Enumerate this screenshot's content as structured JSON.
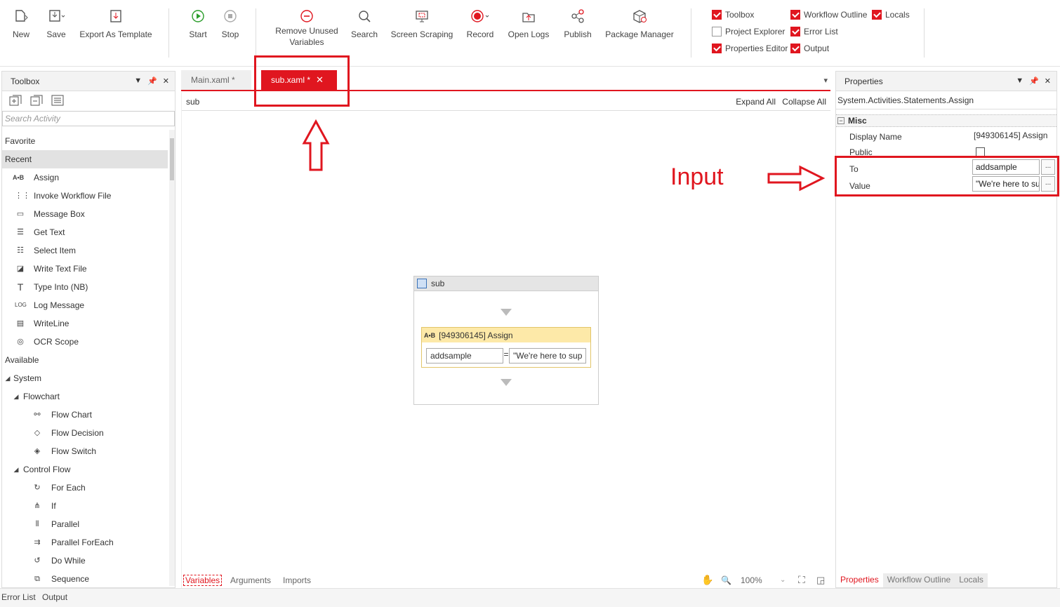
{
  "ribbon": {
    "buttons": [
      {
        "label": "New",
        "icon": "new-file-icon"
      },
      {
        "label": "Save",
        "icon": "save-icon"
      },
      {
        "label": "Export As Template",
        "icon": "export-template-icon"
      },
      {
        "label": "Start",
        "icon": "play-icon"
      },
      {
        "label": "Stop",
        "icon": "stop-icon"
      },
      {
        "label": "Remove Unused\nVariables",
        "icon": "remove-icon"
      },
      {
        "label": "Search",
        "icon": "search-icon"
      },
      {
        "label": "Screen Scraping",
        "icon": "screen-scraping-icon"
      },
      {
        "label": "Record",
        "icon": "record-icon"
      },
      {
        "label": "Open Logs",
        "icon": "open-logs-icon"
      },
      {
        "label": "Publish",
        "icon": "publish-icon"
      },
      {
        "label": "Package Manager",
        "icon": "package-icon"
      }
    ],
    "toggles": [
      {
        "label": "Toolbox",
        "checked": true
      },
      {
        "label": "Workflow Outline",
        "checked": true
      },
      {
        "label": "Locals",
        "checked": true
      },
      {
        "label": "Project Explorer",
        "checked": false
      },
      {
        "label": "Error List",
        "checked": true
      },
      {
        "label": "Properties Editor",
        "checked": true
      },
      {
        "label": "Output",
        "checked": true
      }
    ]
  },
  "toolbox": {
    "title": "Toolbox",
    "search_placeholder": "Search Activity",
    "favorite": "Favorite",
    "recent": "Recent",
    "recent_items": [
      "Assign",
      "Invoke Workflow File",
      "Message Box",
      "Get Text",
      "Select Item",
      "Write Text File",
      "Type Into (NB)",
      "Log Message",
      "WriteLine",
      "OCR Scope"
    ],
    "available": "Available",
    "system": "System",
    "flowchart": "Flowchart",
    "flowchart_items": [
      "Flow Chart",
      "Flow Decision",
      "Flow Switch"
    ],
    "control_flow": "Control Flow",
    "control_items": [
      "For Each",
      "If",
      "Parallel",
      "Parallel ForEach",
      "Do While",
      "Sequence"
    ]
  },
  "tabs": [
    {
      "label": "Main.xaml *",
      "active": false
    },
    {
      "label": "sub.xaml *",
      "active": true
    }
  ],
  "designer": {
    "breadcrumb": "sub",
    "expand_all": "Expand All",
    "collapse_all": "Collapse All",
    "sequence_title": "sub",
    "assign_title": "[949306145] Assign",
    "assign_to": "addsample",
    "assign_eq": "=",
    "assign_value": "\"We're here to sup",
    "bottom_tabs": [
      "Variables",
      "Arguments",
      "Imports"
    ],
    "zoom": "100%"
  },
  "annotation": {
    "input_label": "Input"
  },
  "properties": {
    "title": "Properties",
    "type": "System.Activities.Statements.Assign",
    "category": "Misc",
    "rows": [
      {
        "name": "Display Name",
        "value": "[949306145] Assign"
      },
      {
        "name": "Public",
        "value": ""
      },
      {
        "name": "To",
        "value": "addsample"
      },
      {
        "name": "Value",
        "value": "\"We're here to su"
      }
    ],
    "ellipsis": "...",
    "bottom_tabs": [
      "Properties",
      "Workflow Outline",
      "Locals"
    ]
  },
  "statusbar": {
    "tabs": [
      "Error List",
      "Output"
    ]
  },
  "colors": {
    "accent": "#e0161f",
    "assign_header": "#fde9a8"
  }
}
